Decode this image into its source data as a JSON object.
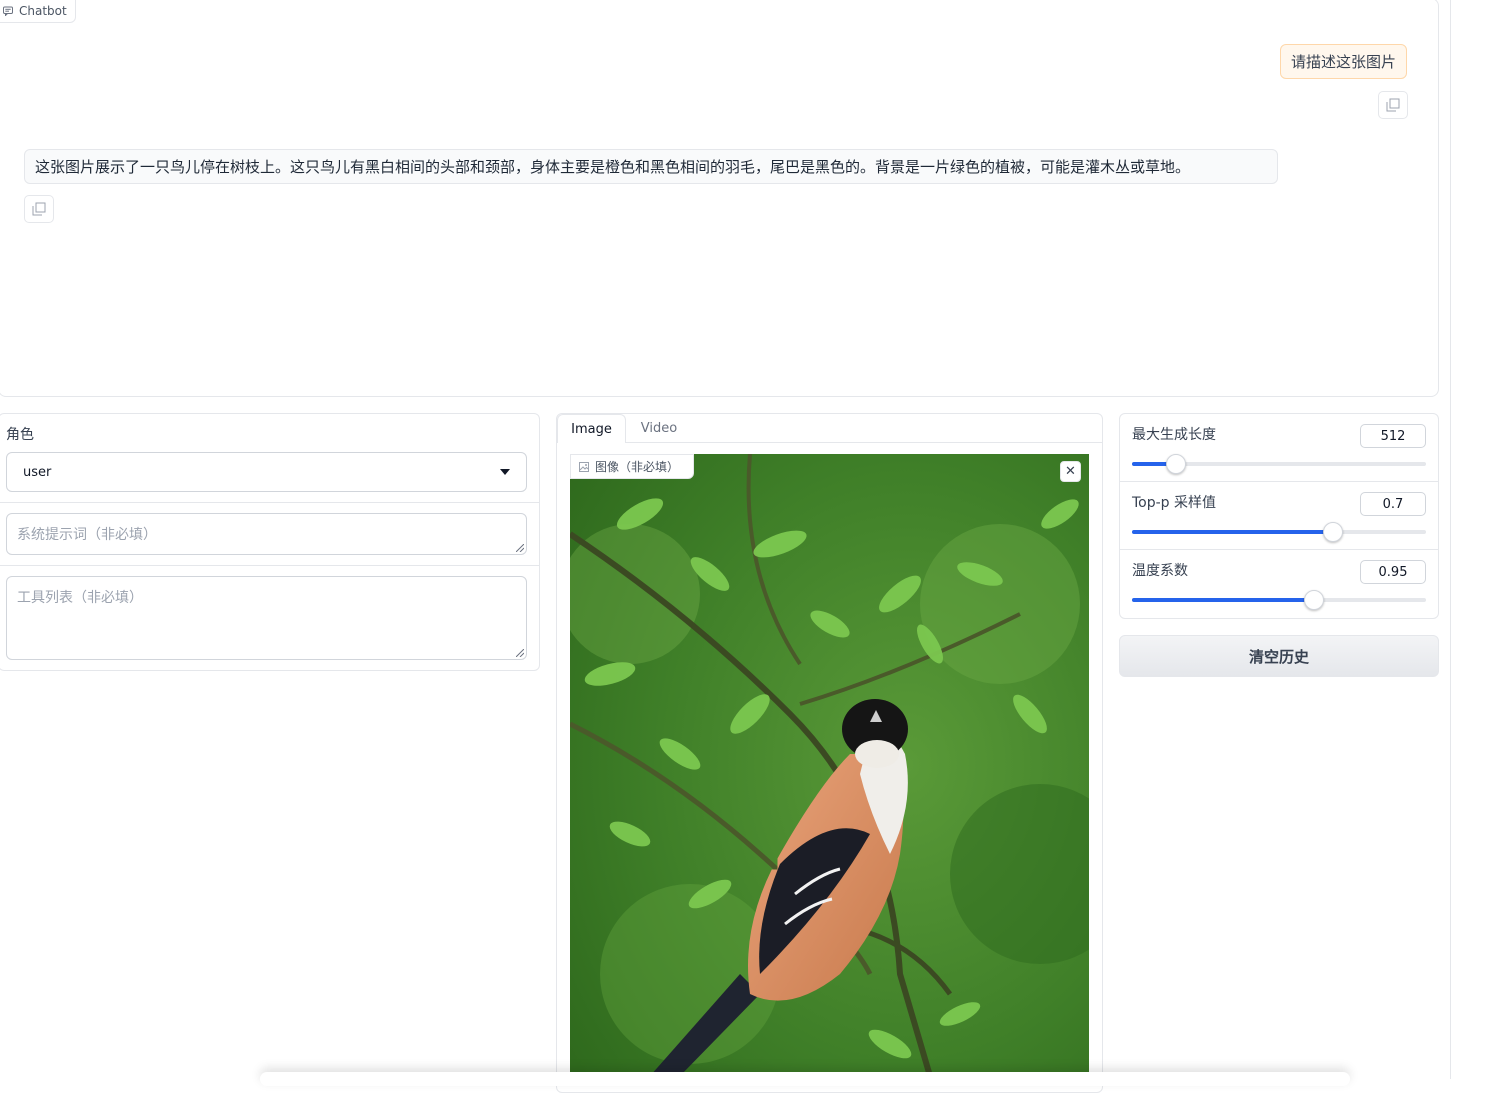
{
  "chatbot": {
    "label": "Chatbot",
    "messages": [
      {
        "role": "user",
        "text": "请描述这张图片"
      },
      {
        "role": "assistant",
        "text": "这张图片展示了一只鸟儿停在树枝上。这只鸟儿有黑白相间的头部和颈部，身体主要是橙色和黑色相间的羽毛，尾巴是黑色的。背景是一片绿色的植被，可能是灌木丛或草地。"
      }
    ]
  },
  "controls": {
    "role_label": "角色",
    "role_value": "user",
    "system_prompt_placeholder": "系统提示词（非必填）",
    "tools_placeholder": "工具列表（非必填）"
  },
  "media": {
    "tabs": [
      {
        "label": "Image",
        "active": true
      },
      {
        "label": "Video",
        "active": false
      }
    ],
    "image_label": "图像（非必填）",
    "image_subject": "bird perched on a green branch"
  },
  "params": {
    "max_length": {
      "label": "最大生成长度",
      "value": "512",
      "fraction": 0.145
    },
    "top_p": {
      "label": "Top-p 采样值",
      "value": "0.7",
      "fraction": 0.679
    },
    "temperature": {
      "label": "温度系数",
      "value": "0.95",
      "fraction": 0.617
    }
  },
  "actions": {
    "clear_label": "清空历史"
  },
  "colors": {
    "accent": "#2563eb",
    "user_bubble": "#fff7ed"
  }
}
